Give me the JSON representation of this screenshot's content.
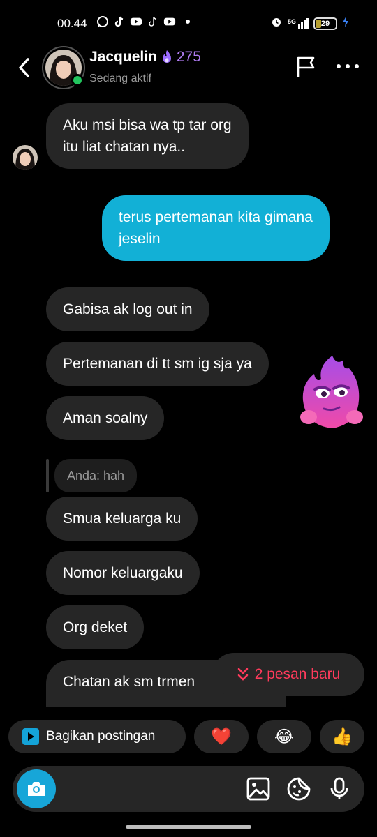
{
  "status_bar": {
    "time": "00.44",
    "app_icons": [
      "whatsapp-icon",
      "tiktok-icon",
      "youtube-icon",
      "tiktok-icon",
      "youtube-icon"
    ],
    "network": "5G",
    "battery": "29",
    "battery_percent": 29
  },
  "header": {
    "name": "Jacquelin",
    "streak": "275",
    "status": "Sedang aktif"
  },
  "messages": [
    {
      "id": "m1",
      "side": "received",
      "lines": [
        "Aku msi bisa wa tp tar org",
        "itu liat chatan nya.."
      ]
    },
    {
      "id": "m2",
      "side": "sent",
      "lines": [
        "terus pertemanan kita gimana",
        "jeselin"
      ]
    },
    {
      "id": "m3",
      "side": "received",
      "lines": [
        "Gabisa ak log out in"
      ]
    },
    {
      "id": "m4",
      "side": "received",
      "lines": [
        "Pertemanan di tt sm ig sja ya"
      ]
    },
    {
      "id": "m5",
      "side": "received",
      "lines": [
        "Aman soalny"
      ]
    },
    {
      "id": "m6",
      "side": "received",
      "lines": [
        "Smua keluarga ku"
      ]
    },
    {
      "id": "m7",
      "side": "received",
      "lines": [
        "Nomor keluargaku"
      ]
    },
    {
      "id": "m8",
      "side": "received",
      "lines": [
        "Org deket"
      ]
    },
    {
      "id": "m9",
      "side": "received",
      "lines": [
        "Chatan ak sm trmen"
      ]
    }
  ],
  "reply_ref": "Anda: hah",
  "new_messages": "2 pesan baru",
  "quick_actions": {
    "share": "Bagikan postingan",
    "heart": "❤️",
    "laugh": "😂",
    "thumb": "👍"
  },
  "colors": {
    "sent_bubble": "#12b0d6",
    "received_bubble": "#262626",
    "streak": "#b07cf2",
    "new_messages": "#ff3b5c",
    "online": "#22c55e"
  }
}
